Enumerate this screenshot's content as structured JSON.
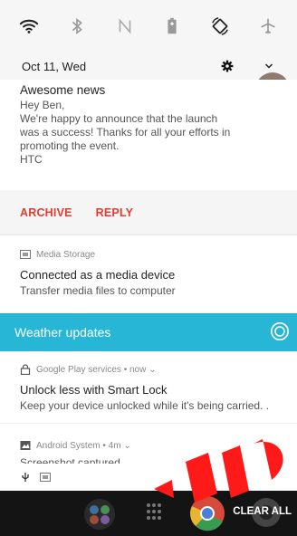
{
  "quick_settings": {
    "icons": [
      "wifi-icon",
      "bluetooth-icon",
      "nfc-icon",
      "battery-saver-icon",
      "auto-rotate-icon",
      "airplane-mode-icon"
    ]
  },
  "date_row": {
    "date": "Oct 11, Wed",
    "settings_icon": "gear-icon",
    "expand_icon": "chevron-down-icon"
  },
  "mail_notification": {
    "title": "Awesome news",
    "lines": [
      "Hey Ben,",
      "We're happy to announce that the launch",
      "was a success! Thanks for all your efforts in",
      "promoting the event.",
      "HTC"
    ],
    "actions": [
      "ARCHIVE",
      "REPLY"
    ]
  },
  "media_notification": {
    "app": "Media Storage",
    "title": "Connected as a media device",
    "text": "Transfer media files to computer"
  },
  "weather_bar": {
    "label": "Weather updates"
  },
  "gplay_notification": {
    "app": "Google Play services • now ⌄",
    "title": "Unlock less with Smart Lock",
    "text": "Keep your device unlocked while it's being carried. ."
  },
  "android_notification": {
    "app": "Android System • 4m ⌄",
    "title": "Screenshot captured"
  },
  "nav_bar": {
    "clear_all": "CLEAR ALL"
  },
  "colors": {
    "accent_red": "#e63a2e",
    "weather_cyan": "#27b6d6",
    "nav_bg": "#141414"
  }
}
